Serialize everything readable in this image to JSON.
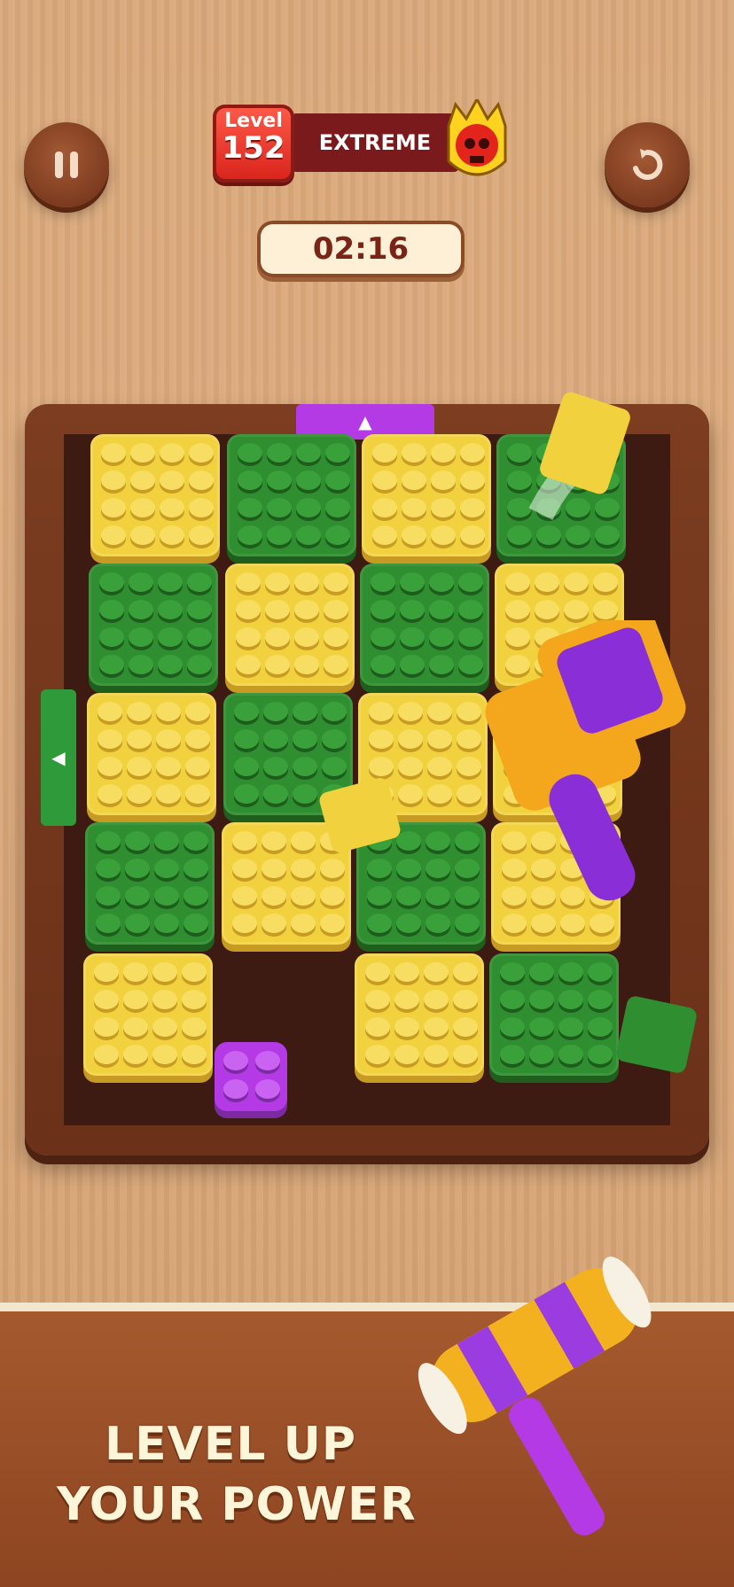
{
  "header": {
    "level_label": "Level",
    "level_number": "152",
    "difficulty": "EXTREME",
    "timer": "02:16"
  },
  "icons": {
    "pause": "pause-icon",
    "restart": "restart-icon",
    "difficulty_badge": "skull-icon",
    "exit_arrow": "triangle-arrow-icon",
    "booster": "hammer-icon"
  },
  "board": {
    "exit_top_color": "purple",
    "exit_left_color": "green",
    "arrow_up": "▲",
    "arrow_left": "◀"
  },
  "promo": {
    "line1": "LEVEL UP",
    "line2": "YOUR POWER"
  },
  "colors": {
    "yellow": "#f1d13d",
    "green": "#2f8e2f",
    "purple": "#b43ae6",
    "wood_frame": "#7c3d20"
  }
}
